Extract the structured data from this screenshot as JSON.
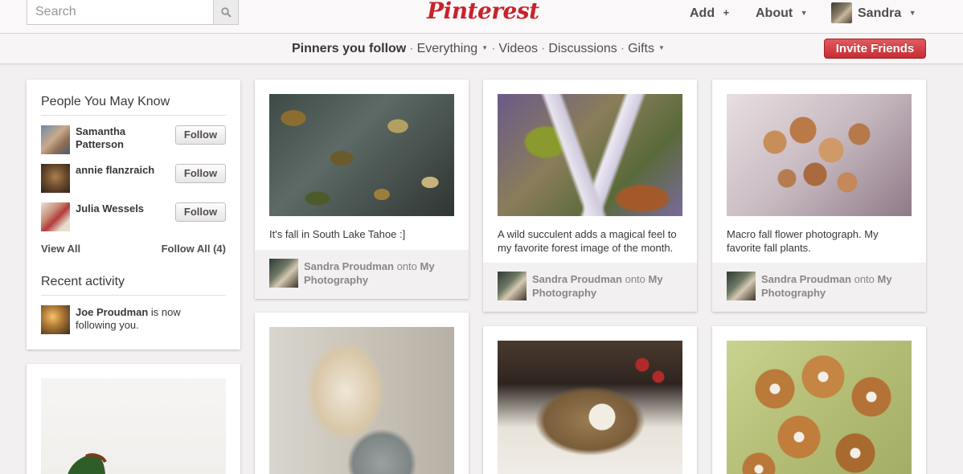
{
  "header": {
    "search_placeholder": "Search",
    "logo": "Pinterest",
    "add_label": "Add",
    "add_icon": "+",
    "about_label": "About",
    "user_name": "Sandra"
  },
  "subnav": {
    "items": [
      "Pinners you follow",
      "Everything",
      "Videos",
      "Discussions",
      "Gifts"
    ],
    "invite_label": "Invite Friends"
  },
  "sidebar": {
    "people_title": "People You May Know",
    "people": [
      {
        "name": "Samantha Patterson",
        "follow_label": "Follow"
      },
      {
        "name": "annie flanzraich",
        "follow_label": "Follow"
      },
      {
        "name": "Julia Wessels",
        "follow_label": "Follow"
      }
    ],
    "view_all": "View All",
    "follow_all": "Follow All (4)",
    "recent_title": "Recent activity",
    "activity": {
      "actor": "Joe Proudman",
      "text": "is now following you."
    }
  },
  "pins": [
    {
      "description": "It's fall in South Lake Tahoe :]",
      "pinner": "Sandra Proudman",
      "onto": "onto",
      "board": "My Photography"
    },
    {
      "description": "A wild succulent adds a magical feel to my favorite forest image of the month.",
      "pinner": "Sandra Proudman",
      "onto": "onto",
      "board": "My Photography"
    },
    {
      "description": "Macro fall flower photograph. My favorite fall plants.",
      "pinner": "Sandra Proudman",
      "onto": "onto",
      "board": "My Photography"
    }
  ],
  "colors": {
    "brand_red": "#c8232c",
    "page_bg": "#f2f0f0"
  }
}
